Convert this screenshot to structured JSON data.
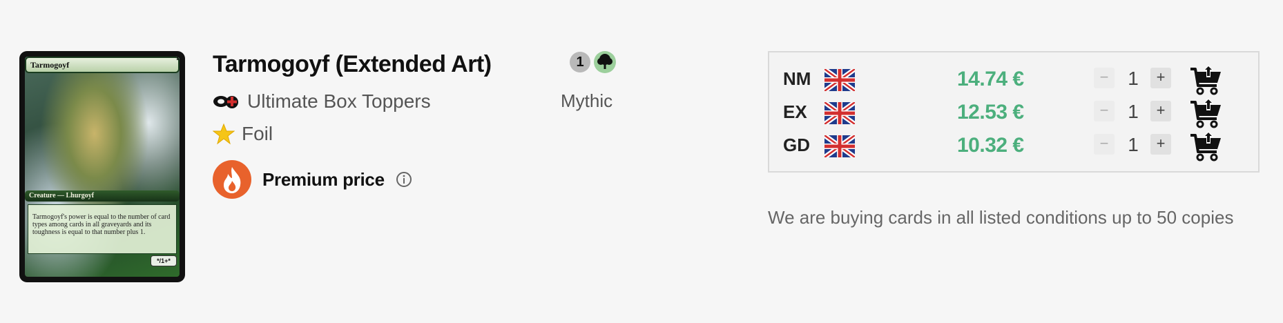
{
  "card_image": {
    "title": "Tarmogoyf",
    "cost": "1",
    "type_line": "Creature — Lhurgoyf",
    "rules_text": "Tarmogoyf's power is equal to the number of card types among cards in all graveyards and its toughness is equal to that number plus 1.",
    "pt": "*/1+*"
  },
  "product": {
    "name": "Tarmogoyf (Extended Art)",
    "set_icon": "set-symbol-icon",
    "set_name": "Ultimate Box Toppers",
    "foil_icon": "star-icon",
    "foil_label": "Foil",
    "premium_icon": "fire-icon",
    "premium_label": "Premium price",
    "info_icon": "info-icon",
    "mana_generic": "1",
    "mana_color": "green",
    "rarity": "Mythic"
  },
  "offers": [
    {
      "condition": "NM",
      "language_flag": "uk-flag-icon",
      "price": "14.74 €",
      "qty": "1"
    },
    {
      "condition": "EX",
      "language_flag": "uk-flag-icon",
      "price": "12.53 €",
      "qty": "1"
    },
    {
      "condition": "GD",
      "language_flag": "uk-flag-icon",
      "price": "10.32 €",
      "qty": "1"
    }
  ],
  "controls": {
    "minus": "−",
    "plus": "+"
  },
  "colors": {
    "price": "#4caf7d",
    "mana_green": "#2e8b3a"
  },
  "buying_note": "We are buying cards in all listed conditions up to 50 copies"
}
